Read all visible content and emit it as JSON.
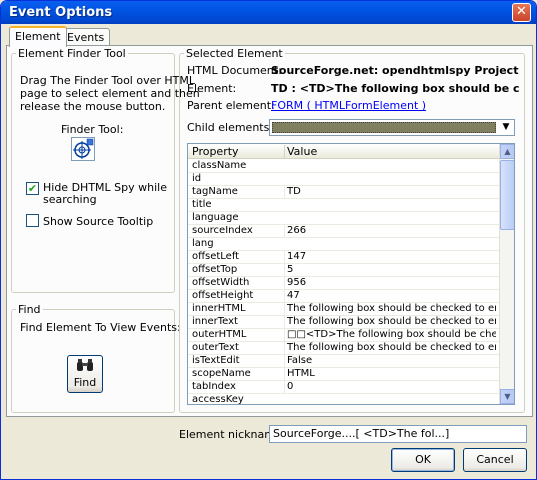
{
  "window": {
    "title": "Event Options",
    "close_glyph": "✕"
  },
  "tabs": [
    {
      "label": "Element",
      "active": true
    },
    {
      "label": "Events",
      "active": false
    }
  ],
  "finder": {
    "group_title": "Element Finder Tool",
    "instructions_1": "Drag The Finder Tool over HTML",
    "instructions_2": "page to select element and then",
    "instructions_3": "release the mouse button.",
    "tool_label": "Finder Tool:",
    "hide_spy_line1": "Hide DHTML Spy while",
    "hide_spy_line2": "searching",
    "hide_spy_checked": true,
    "show_tooltip_label": "Show Source Tooltip",
    "show_tooltip_checked": false
  },
  "find": {
    "group_title": "Find",
    "description": "Find Element To View Events:",
    "button_label": "Find"
  },
  "selected": {
    "group_title": "Selected Element",
    "html_document_label": "HTML Document:",
    "html_document_value": "SourceForge.net: opendhtmlspy Project: Admi",
    "element_label": "Element:",
    "element_value": "TD : <TD>The following box should be checked",
    "parent_label": "Parent element:",
    "parent_value": "FORM ( HTMLFormElement )",
    "child_label": "Child elements:"
  },
  "grid": {
    "col_property": "Property",
    "col_value": "Value",
    "rows": [
      {
        "property": "className",
        "value": ""
      },
      {
        "property": "id",
        "value": ""
      },
      {
        "property": "tagName",
        "value": "TD"
      },
      {
        "property": "title",
        "value": ""
      },
      {
        "property": "language",
        "value": ""
      },
      {
        "property": "sourceIndex",
        "value": "266"
      },
      {
        "property": "lang",
        "value": ""
      },
      {
        "property": "offsetLeft",
        "value": "147"
      },
      {
        "property": "offsetTop",
        "value": "5"
      },
      {
        "property": "offsetWidth",
        "value": "956"
      },
      {
        "property": "offsetHeight",
        "value": "47"
      },
      {
        "property": "innerHTML",
        "value": "The following box should be checked to en..."
      },
      {
        "property": "innerText",
        "value": "The following box should be checked to en..."
      },
      {
        "property": "outerHTML",
        "value": "□□<TD>The following box should be che..."
      },
      {
        "property": "outerText",
        "value": "The following box should be checked to en..."
      },
      {
        "property": "isTextEdit",
        "value": "False"
      },
      {
        "property": "scopeName",
        "value": "HTML"
      },
      {
        "property": "tabIndex",
        "value": "0"
      },
      {
        "property": "accessKey",
        "value": ""
      }
    ]
  },
  "nickname": {
    "label": "Element nickname:",
    "value": "SourceForge....[ <TD>The fol...]"
  },
  "buttons": {
    "ok": "OK",
    "cancel": "Cancel"
  }
}
